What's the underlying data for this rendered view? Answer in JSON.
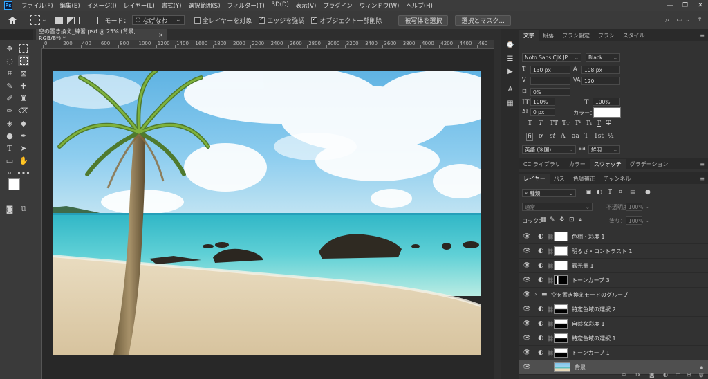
{
  "app": {
    "logo": "Ps"
  },
  "menubar": {
    "items": [
      "ファイル(F)",
      "編集(E)",
      "イメージ(I)",
      "レイヤー(L)",
      "書式(Y)",
      "選択範囲(S)",
      "フィルター(T)",
      "3D(D)",
      "表示(V)",
      "プラグイン",
      "ウィンドウ(W)",
      "ヘルプ(H)"
    ]
  },
  "options": {
    "mode_label": "モード：",
    "mode_value": "なげなわ",
    "sample_all": "全レイヤーを対象",
    "enhance_edge": "エッジを強調",
    "object_subtract": "オブジェクト一部削除",
    "select_subject": "被写体を選択",
    "select_mask": "選択とマスク..."
  },
  "document": {
    "tab_title": "空の置き換え_練習.psd @ 25% (背景, RGB/8*) *",
    "close": "×"
  },
  "ruler": {
    "labels": [
      "0",
      "200",
      "400",
      "600",
      "800",
      "1000",
      "1200",
      "1400",
      "1600",
      "1800",
      "2000",
      "2200",
      "2400",
      "2600",
      "2800",
      "3000",
      "3200",
      "3400",
      "3600",
      "3800",
      "4000",
      "4200",
      "4400",
      "460"
    ]
  },
  "character_panel": {
    "tabs": [
      "文字",
      "段落",
      "ブラシ設定",
      "ブラシ",
      "スタイル"
    ],
    "font_family": "Noto Sans CJK JP",
    "font_style": "Black",
    "font_size": "130 px",
    "leading": "108 px",
    "kerning": "",
    "tracking": "120",
    "tsume": "0%",
    "vscale": "100%",
    "hscale": "100%",
    "baseline": "0 px",
    "color_label": "カラー：",
    "color_value": "#ffffff",
    "language": "英語 (米国)",
    "aa_label": "a",
    "aa_value": "鮮明"
  },
  "layers_panel": {
    "top_tabs": [
      "CC ライブラリ",
      "カラー",
      "スウォッチ",
      "グラデーション"
    ],
    "tabs": [
      "レイヤー",
      "パス",
      "色調補正",
      "チャンネル"
    ],
    "filter_label": "種類",
    "blend_mode": "通常",
    "opacity_label": "不透明度：",
    "opacity_value": "100%",
    "lock_label": "ロック：",
    "fill_label": "塗り：",
    "fill_value": "100%",
    "layers": [
      {
        "name": "色相・彩度 1",
        "type": "adjust",
        "mask": "white"
      },
      {
        "name": "明るさ・コントラスト 1",
        "type": "adjust",
        "mask": "white"
      },
      {
        "name": "露光量 1",
        "type": "adjust",
        "mask": "white"
      },
      {
        "name": "トーンカーブ 3",
        "type": "adjust",
        "mask": "tree"
      },
      {
        "name": "空を置き換えモードのグループ",
        "type": "group"
      },
      {
        "name": "特定色域の選択 2",
        "type": "adjust",
        "mask": "sky"
      },
      {
        "name": "自然な彩度 1",
        "type": "adjust",
        "mask": "sky"
      },
      {
        "name": "特定色域の選択 1",
        "type": "adjust",
        "mask": "sky"
      },
      {
        "name": "トーンカーブ 1",
        "type": "adjust",
        "mask": "sky"
      },
      {
        "name": "背景",
        "type": "image"
      }
    ]
  }
}
